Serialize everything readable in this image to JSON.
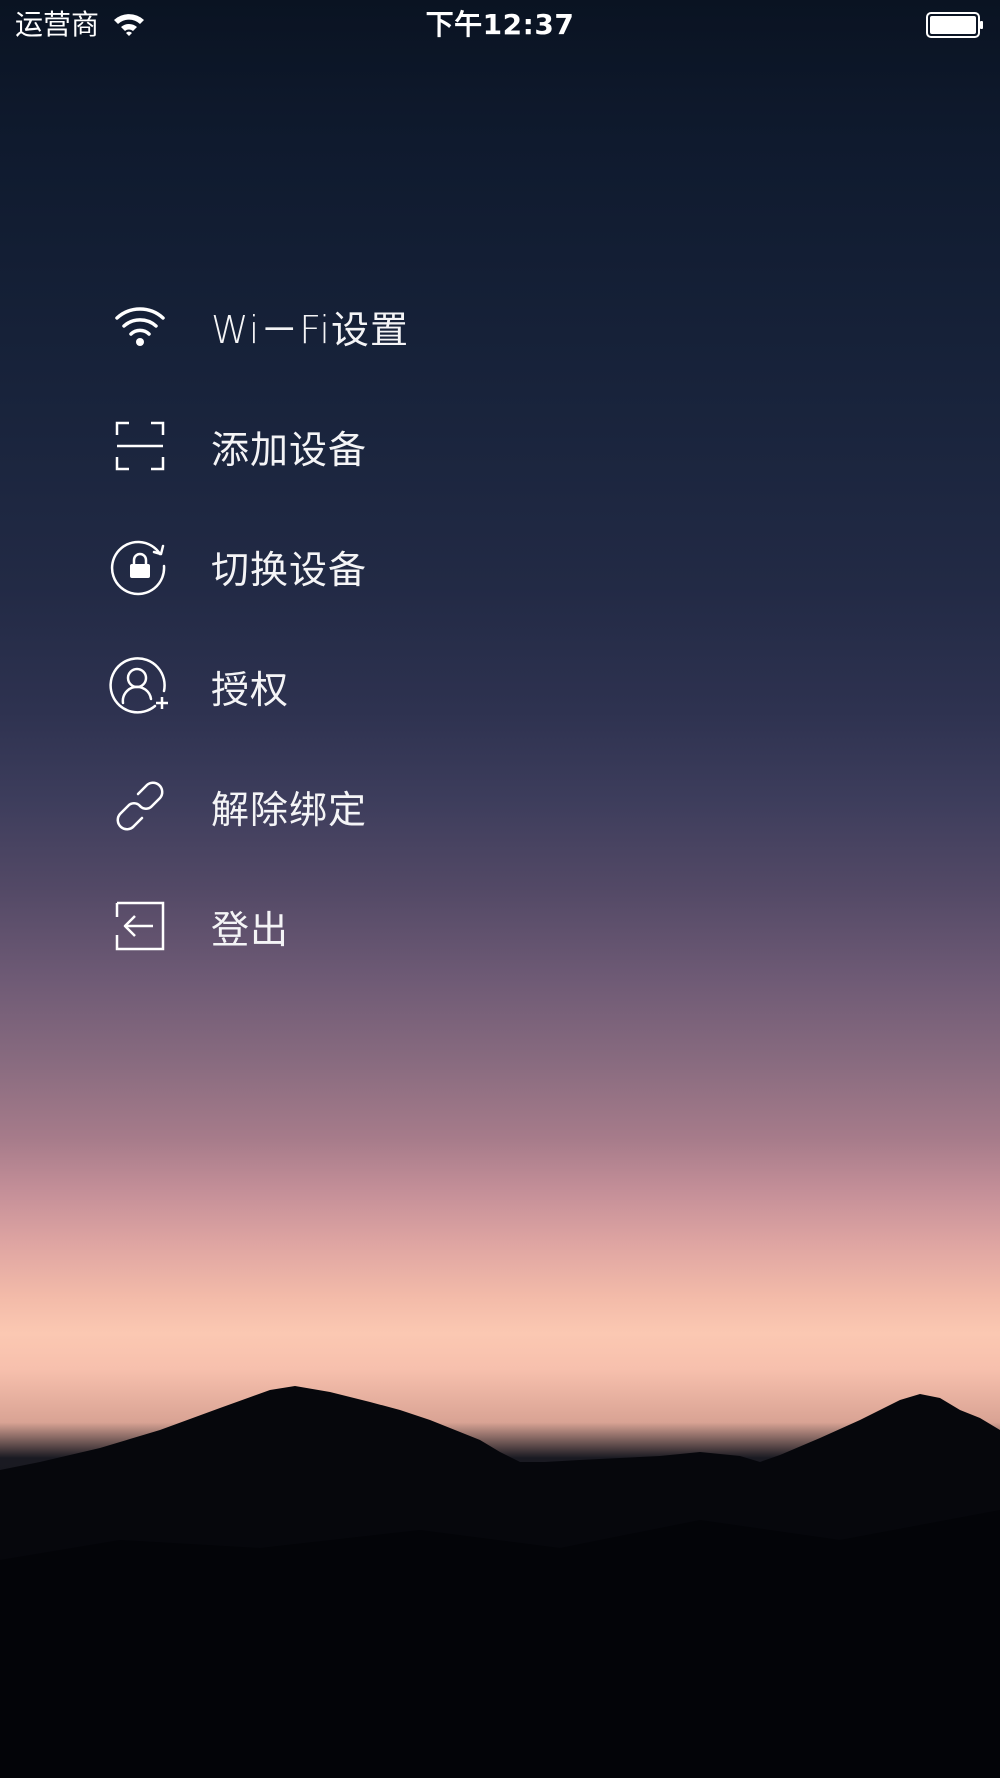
{
  "status_bar": {
    "carrier": "运营商",
    "time": "下午12:37",
    "wifi_icon": "wifi-icon",
    "battery_icon": "battery-icon"
  },
  "menu": {
    "items": [
      {
        "label": "Wi－Fi设置",
        "icon": "wifi-icon"
      },
      {
        "label": "添加设备",
        "icon": "scan-icon"
      },
      {
        "label": "切换设备",
        "icon": "switch-lock-icon"
      },
      {
        "label": "授权",
        "icon": "add-user-icon"
      },
      {
        "label": "解除绑定",
        "icon": "unlink-icon"
      },
      {
        "label": "登出",
        "icon": "logout-icon"
      }
    ]
  },
  "colors": {
    "text": "#ffffff",
    "sky_top": "#0a1322",
    "sky_mid": "#534966",
    "sky_glow": "#fbc8b2",
    "mountain": "#05060a"
  }
}
